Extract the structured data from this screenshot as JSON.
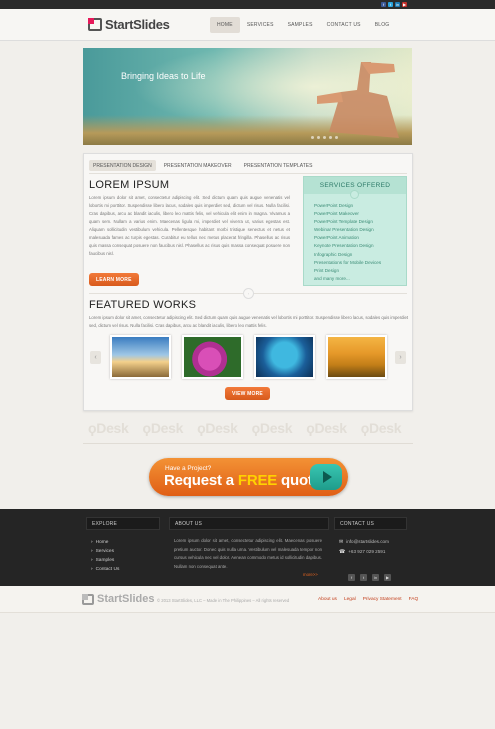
{
  "header": {
    "logo": "StartSlides",
    "nav": [
      "HOME",
      "SERVICES",
      "SAMPLES",
      "CONTACT US",
      "BLOG"
    ]
  },
  "social_icons": [
    "facebook-icon",
    "twitter-icon",
    "linkedin-icon",
    "youtube-icon"
  ],
  "hero": {
    "title": "Bringing Ideas to Life"
  },
  "tabs": [
    "PRESENTATION DESIGN",
    "PRESENTATION MAKEOVER",
    "PRESENTATION TEMPLATES"
  ],
  "intro": {
    "title": "LOREM IPSUM",
    "body": "Lorem ipsum dolor sit amet, consectetur adipiscing elit. Sed dictum quam quis augue venenatis vel lobortis mi porttitor. Suspendisse libero lacus, sodales quis imperdiet sed, dictum vel risus. Nulla facilisi. Cras dapibus, arcu ac blandit iaculis, libero leo mattis felis, vel vehicula elit enim in magna. Vivamus a quam sem. Nullam a varius enim. Maecenas ligula mi, imperdiet vel viverra ut, varius egestas est. Aliquam sollicitudin vestibulum vehicula. Pellentesque habitant morbi tristique senectus et netus et malesuada fames ac turpis egestas. Curabitur eu tellus nec metus placerat fringilla. Phasellus ac risus quis massa consequat posuere non faucibus nisl. Phasellus ac risus quis massa consequat posuere non faucibus nisl.",
    "button": "LEARN MORE"
  },
  "services": {
    "title": "SERVICES OFFERED",
    "items": [
      "PowerPoint Design",
      "PowerPoint Makeover",
      "PowerPoint Template Design",
      "Webinar Presentation Design",
      "PowerPoint Animation",
      "Keynote Presentation Design",
      "Infographic Design",
      "Presentations for Mobile Devices",
      "Print Design",
      "and many more..."
    ]
  },
  "featured": {
    "title": "FEATURED WORKS",
    "body": "Lorem ipsum dolor sit amet, consectetur adipiscing elit. Sed dictum quam quis augue venenatis vel lobortis mi porttitor. Suspendisse libero lacus, sodales quis imperdiet sed, dictum vel risus. Nulla facilisi. Cras dapibus, arcu ac blandit iaculis, libero leo mattis felis.",
    "button": "VIEW MORE",
    "prev": "‹",
    "next": "›"
  },
  "partners": [
    "Desk",
    "Desk",
    "Desk",
    "Desk",
    "Desk",
    "Desk"
  ],
  "quote_cta": {
    "sub": "Have a Project?",
    "main_prefix": "Request a ",
    "main_free": "FREE",
    "main_suffix": " quote."
  },
  "footer": {
    "explore_title": "EXPLORE",
    "explore_links": [
      "Home",
      "Services",
      "Samples",
      "Contact Us"
    ],
    "about_title": "ABOUT US",
    "about_text": "Lorem ipsum dolor sit amet, consectetur adipiscing elit. Maecenas posuere pretium auctor. Donec quis nulla urna. Vestibulum vel malesuada tempor non cursus vehicula nec vel dolor. Aenean commodo metus id sollicitudin dapibus. Nullam non consequat ante.",
    "about_more": "more>>",
    "contact_title": "CONTACT US",
    "email": "info@startslides.com",
    "phone": "+63 927 029 2591"
  },
  "bottom": {
    "logo": "StartSlides",
    "copyright": "© 2013 StartSlides, LLC – Made in The Philippines – All rights reserved",
    "links": [
      "About us",
      "Legal",
      "Privacy Statement",
      "FAQ"
    ]
  },
  "colors": {
    "accent": "#e0621f",
    "services_bg": "#c9ece1",
    "footer_bg": "#252525"
  }
}
